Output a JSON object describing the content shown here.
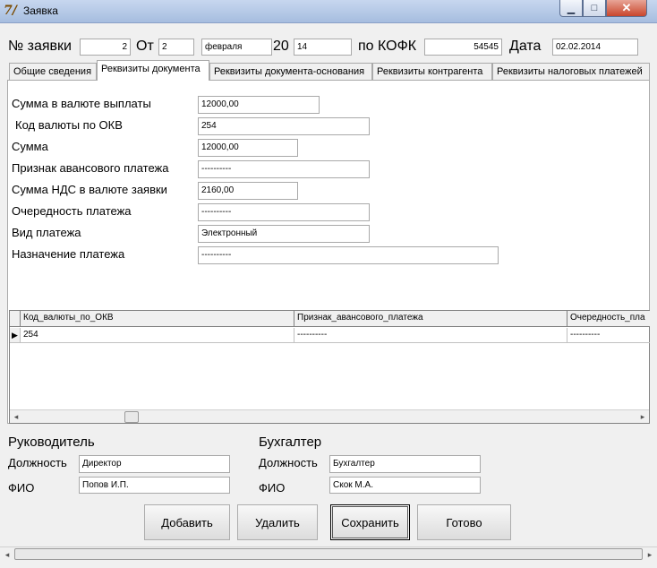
{
  "window": {
    "title": "Заявка"
  },
  "header": {
    "number_label": "№ заявки",
    "number_value": "2",
    "from_label": "От",
    "day_value": "2",
    "month_value": "февраля",
    "century_label": "20",
    "year_value": "14",
    "kofk_label": "по КОФК",
    "kofk_value": "54545",
    "date_label": "Дата",
    "date_value": "02.02.2014"
  },
  "tabs": [
    {
      "label": "Общие сведения"
    },
    {
      "label": "Реквизиты документа"
    },
    {
      "label": "Реквизиты документа-основания"
    },
    {
      "label": "Реквизиты контрагента"
    },
    {
      "label": "Реквизиты налоговых платежей"
    }
  ],
  "active_tab": "Реквизиты документа",
  "fields": {
    "sum_currency": {
      "label": "Сумма в валюте выплаты",
      "value": "12000,00"
    },
    "currency_code": {
      "label": "Код валюты по ОКВ",
      "value": "254"
    },
    "sum": {
      "label": "Сумма",
      "value": "12000,00"
    },
    "advance": {
      "label": "Признак авансового платежа",
      "value": "----------"
    },
    "vat": {
      "label": "Сумма НДС в валюте заявки",
      "value": "2160,00"
    },
    "priority": {
      "label": "Очередность платежа",
      "value": "----------"
    },
    "payment_type": {
      "label": "Вид платежа",
      "value": "Электронный"
    },
    "purpose": {
      "label": "Назначение платежа",
      "value": "----------"
    }
  },
  "grid": {
    "columns": [
      "Код_валюты_по_ОКВ",
      "Признак_авансового_платежа",
      "Очередность_пла"
    ],
    "rows": [
      [
        "254",
        "----------",
        "----------"
      ]
    ]
  },
  "signatures": {
    "head": {
      "title": "Руководитель",
      "position_label": "Должность",
      "position_value": "Директор",
      "name_label": "ФИО",
      "name_value": "Попов И.П."
    },
    "accountant": {
      "title": "Бухгалтер",
      "position_label": "Должность",
      "position_value": "Бухгалтер",
      "name_label": "ФИО",
      "name_value": "Скок М.А."
    }
  },
  "buttons": {
    "add": "Добавить",
    "delete": "Удалить",
    "save": "Сохранить",
    "done": "Готово"
  },
  "icons": {
    "app": "app-logo-icon",
    "minimize": "minimize-icon",
    "maximize": "maximize-icon",
    "close": "close-icon",
    "row_pointer": "row-pointer-icon",
    "scroll_left": "arrow-left-icon",
    "scroll_right": "arrow-right-icon"
  }
}
